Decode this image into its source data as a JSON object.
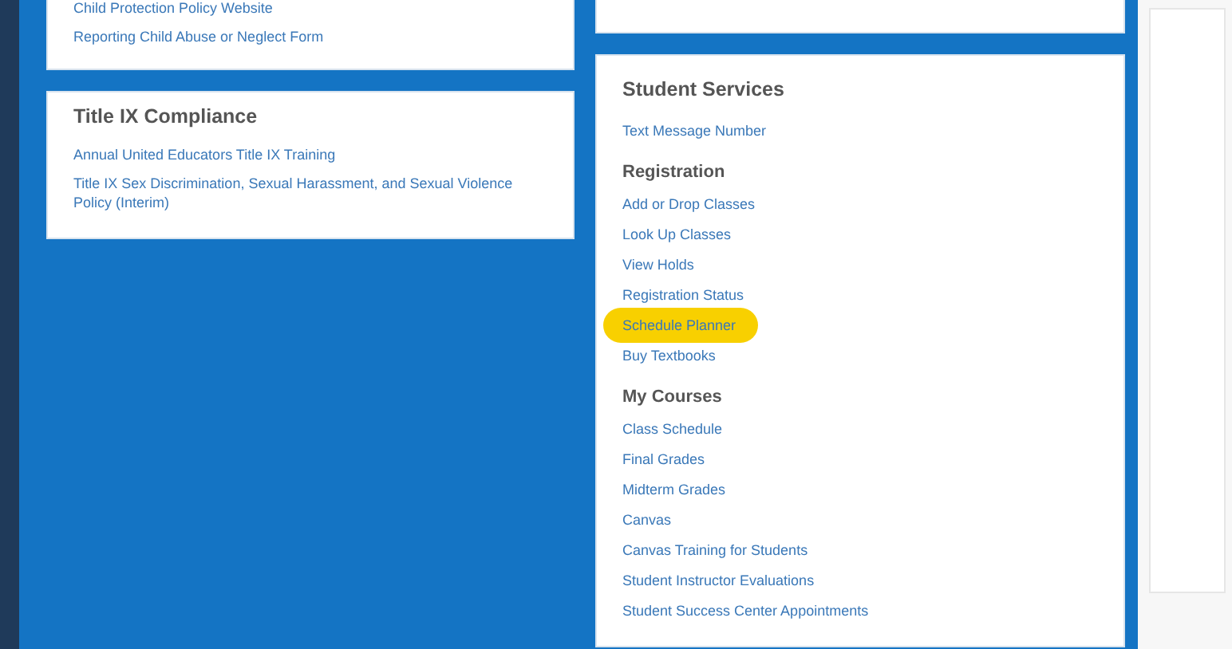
{
  "left_cards": [
    {
      "links": [
        {
          "label": "Child Protection Policy Website",
          "highlighted": false
        },
        {
          "label": "Reporting Child Abuse or Neglect Form",
          "highlighted": false
        }
      ]
    },
    {
      "title": "Title IX Compliance",
      "links": [
        {
          "label": "Annual United Educators Title IX Training",
          "highlighted": false
        },
        {
          "label": "Title IX Sex Discrimination, Sexual Harassment, and Sexual Violence Policy (Interim)",
          "highlighted": false
        }
      ]
    }
  ],
  "student_services": {
    "title": "Student Services",
    "sections": [
      {
        "links": [
          {
            "label": "Text Message Number",
            "highlighted": false
          }
        ]
      },
      {
        "heading": "Registration",
        "links": [
          {
            "label": "Add or Drop Classes",
            "highlighted": false
          },
          {
            "label": "Look Up Classes",
            "highlighted": false
          },
          {
            "label": "View Holds",
            "highlighted": false
          },
          {
            "label": "Registration Status",
            "highlighted": false
          },
          {
            "label": "Schedule Planner",
            "highlighted": true
          },
          {
            "label": "Buy Textbooks",
            "highlighted": false
          }
        ]
      },
      {
        "heading": "My Courses",
        "links": [
          {
            "label": "Class Schedule",
            "highlighted": false
          },
          {
            "label": "Final Grades",
            "highlighted": false
          },
          {
            "label": "Midterm Grades",
            "highlighted": false
          },
          {
            "label": "Canvas",
            "highlighted": false
          },
          {
            "label": "Canvas Training for Students",
            "highlighted": false
          },
          {
            "label": "Student Instructor Evaluations",
            "highlighted": false
          },
          {
            "label": "Student Success Center Appointments",
            "highlighted": false
          }
        ]
      }
    ]
  }
}
